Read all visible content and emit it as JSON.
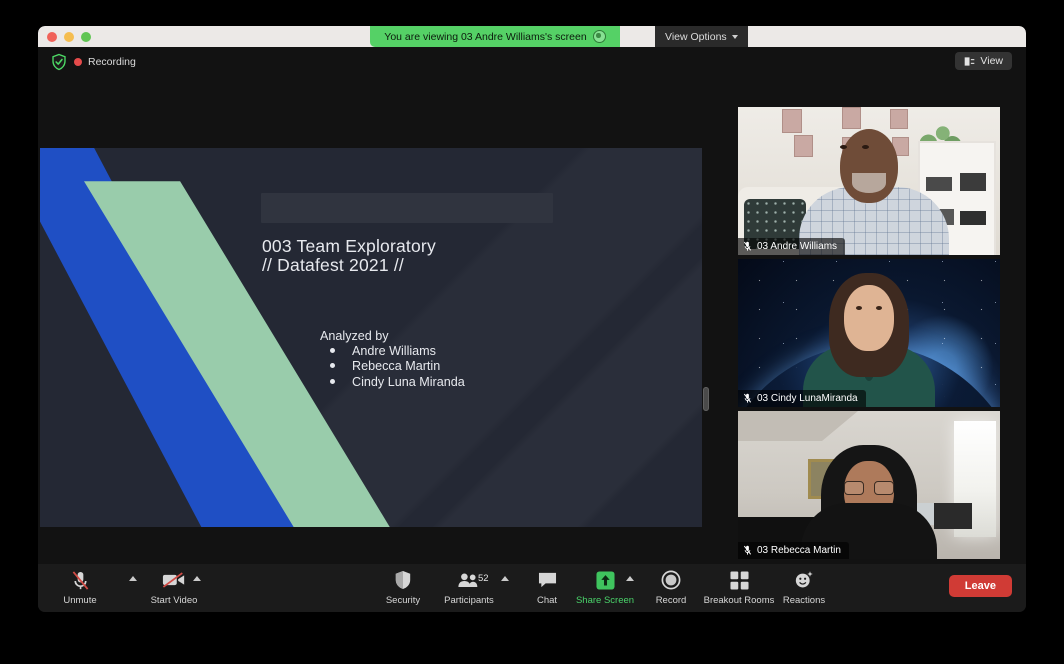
{
  "window": {
    "traffic_lights": [
      "close",
      "minimize",
      "zoom"
    ]
  },
  "banner": {
    "viewing_text": "You are viewing 03 Andre Williams's screen",
    "recording_indicator_icon": "record-circle-icon",
    "view_options_label": "View Options",
    "chevron_icon": "chevron-down-icon"
  },
  "topbar": {
    "shield_icon": "shield-check-icon",
    "recording_label": "Recording",
    "recording_dot_color": "#e54b4b",
    "view_button_label": "View",
    "view_button_icon": "layout-view-icon"
  },
  "slide": {
    "title": "003 Team Exploratory\n// Datafest 2021 //",
    "analyzed_label": "Analyzed by",
    "authors": [
      "Andre Williams",
      "Rebecca Martin",
      "Cindy Luna Miranda"
    ],
    "colors": {
      "background": "#242834",
      "accent_blue": "#1f4fc4",
      "accent_green": "#99ccab",
      "placeholder": "#30343f",
      "text": "#e7e9ee"
    }
  },
  "participants": [
    {
      "name": "03 Andre Williams",
      "muted": true,
      "mic_icon": "mic-off-icon"
    },
    {
      "name": "03 Cindy LunaMiranda",
      "muted": true,
      "mic_icon": "mic-off-icon"
    },
    {
      "name": "03 Rebecca Martin",
      "muted": true,
      "mic_icon": "mic-off-icon"
    }
  ],
  "toolbar": {
    "items": [
      {
        "label": "Unmute",
        "icon": "mic-off-icon",
        "caret": true,
        "state": "muted"
      },
      {
        "label": "Start Video",
        "icon": "video-off-icon",
        "caret": true,
        "state": "video-off"
      },
      {
        "label": "Security",
        "icon": "shield-icon",
        "caret": false,
        "state": "normal"
      },
      {
        "label": "Participants",
        "icon": "people-icon",
        "caret": true,
        "state": "normal",
        "count": "52"
      },
      {
        "label": "Chat",
        "icon": "chat-bubble-icon",
        "caret": false,
        "state": "normal"
      },
      {
        "label": "Share Screen",
        "icon": "share-screen-icon",
        "caret": true,
        "state": "active"
      },
      {
        "label": "Record",
        "icon": "record-icon",
        "caret": false,
        "state": "normal"
      },
      {
        "label": "Breakout Rooms",
        "icon": "grid-squares-icon",
        "caret": false,
        "state": "normal"
      },
      {
        "label": "Reactions",
        "icon": "smiley-sparkle-icon",
        "caret": false,
        "state": "normal"
      }
    ],
    "leave_label": "Leave",
    "leave_color": "#d03b35",
    "active_color": "#4ad36a"
  }
}
